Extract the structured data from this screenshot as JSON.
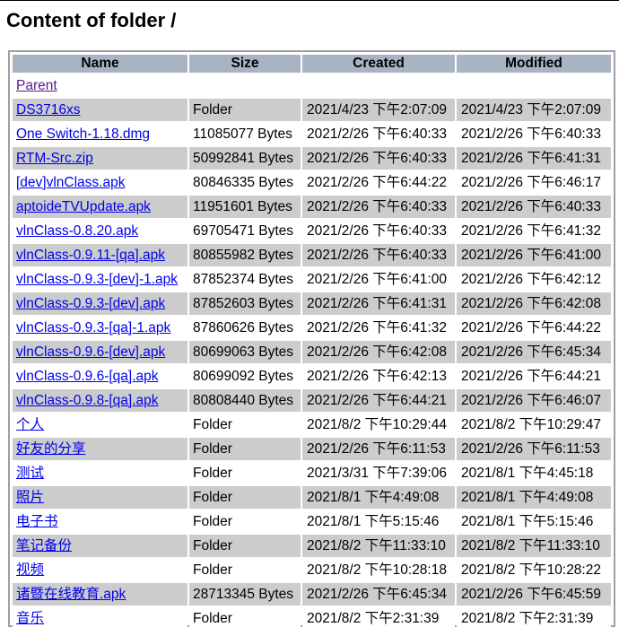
{
  "page": {
    "title": "Content of folder /"
  },
  "table": {
    "headers": {
      "name": "Name",
      "size": "Size",
      "created": "Created",
      "modified": "Modified"
    },
    "parent_label": "Parent",
    "rows": [
      {
        "name": "DS3716xs",
        "size": "Folder",
        "created": "2021/4/23 下午2:07:09",
        "modified": "2021/4/23 下午2:07:09"
      },
      {
        "name": "One Switch-1.18.dmg",
        "size": "11085077 Bytes",
        "created": "2021/2/26 下午6:40:33",
        "modified": "2021/2/26 下午6:40:33"
      },
      {
        "name": "RTM-Src.zip",
        "size": "50992841 Bytes",
        "created": "2021/2/26 下午6:40:33",
        "modified": "2021/2/26 下午6:41:31"
      },
      {
        "name": "[dev]vlnClass.apk",
        "size": "80846335 Bytes",
        "created": "2021/2/26 下午6:44:22",
        "modified": "2021/2/26 下午6:46:17"
      },
      {
        "name": "aptoideTVUpdate.apk",
        "size": "11951601 Bytes",
        "created": "2021/2/26 下午6:40:33",
        "modified": "2021/2/26 下午6:40:33"
      },
      {
        "name": "vlnClass-0.8.20.apk",
        "size": "69705471 Bytes",
        "created": "2021/2/26 下午6:40:33",
        "modified": "2021/2/26 下午6:41:32"
      },
      {
        "name": "vlnClass-0.9.11-[qa].apk",
        "size": "80855982 Bytes",
        "created": "2021/2/26 下午6:40:33",
        "modified": "2021/2/26 下午6:41:00"
      },
      {
        "name": "vlnClass-0.9.3-[dev]-1.apk",
        "size": "87852374 Bytes",
        "created": "2021/2/26 下午6:41:00",
        "modified": "2021/2/26 下午6:42:12"
      },
      {
        "name": "vlnClass-0.9.3-[dev].apk",
        "size": "87852603 Bytes",
        "created": "2021/2/26 下午6:41:31",
        "modified": "2021/2/26 下午6:42:08"
      },
      {
        "name": "vlnClass-0.9.3-[qa]-1.apk",
        "size": "87860626 Bytes",
        "created": "2021/2/26 下午6:41:32",
        "modified": "2021/2/26 下午6:44:22"
      },
      {
        "name": "vlnClass-0.9.6-[dev].apk",
        "size": "80699063 Bytes",
        "created": "2021/2/26 下午6:42:08",
        "modified": "2021/2/26 下午6:45:34"
      },
      {
        "name": "vlnClass-0.9.6-[qa].apk",
        "size": "80699092 Bytes",
        "created": "2021/2/26 下午6:42:13",
        "modified": "2021/2/26 下午6:44:21"
      },
      {
        "name": "vlnClass-0.9.8-[qa].apk",
        "size": "80808440 Bytes",
        "created": "2021/2/26 下午6:44:21",
        "modified": "2021/2/26 下午6:46:07"
      },
      {
        "name": "个人",
        "size": "Folder",
        "created": "2021/8/2 下午10:29:44",
        "modified": "2021/8/2 下午10:29:47"
      },
      {
        "name": "好友的分享",
        "size": "Folder",
        "created": "2021/2/26 下午6:11:53",
        "modified": "2021/2/26 下午6:11:53"
      },
      {
        "name": "测试",
        "size": "Folder",
        "created": "2021/3/31 下午7:39:06",
        "modified": "2021/8/1 下午4:45:18"
      },
      {
        "name": "照片",
        "size": "Folder",
        "created": "2021/8/1 下午4:49:08",
        "modified": "2021/8/1 下午4:49:08"
      },
      {
        "name": "电子书",
        "size": "Folder",
        "created": "2021/8/1 下午5:15:46",
        "modified": "2021/8/1 下午5:15:46"
      },
      {
        "name": "笔记备份",
        "size": "Folder",
        "created": "2021/8/2 下午11:33:10",
        "modified": "2021/8/2 下午11:33:10"
      },
      {
        "name": "视频",
        "size": "Folder",
        "created": "2021/8/2 下午10:28:18",
        "modified": "2021/8/2 下午10:28:22"
      },
      {
        "name": "诸暨在线教育.apk",
        "size": "28713345 Bytes",
        "created": "2021/2/26 下午6:45:34",
        "modified": "2021/2/26 下午6:45:59"
      },
      {
        "name": "音乐",
        "size": "Folder",
        "created": "2021/8/2 下午2:31:39",
        "modified": "2021/8/2 下午2:31:39"
      }
    ]
  }
}
